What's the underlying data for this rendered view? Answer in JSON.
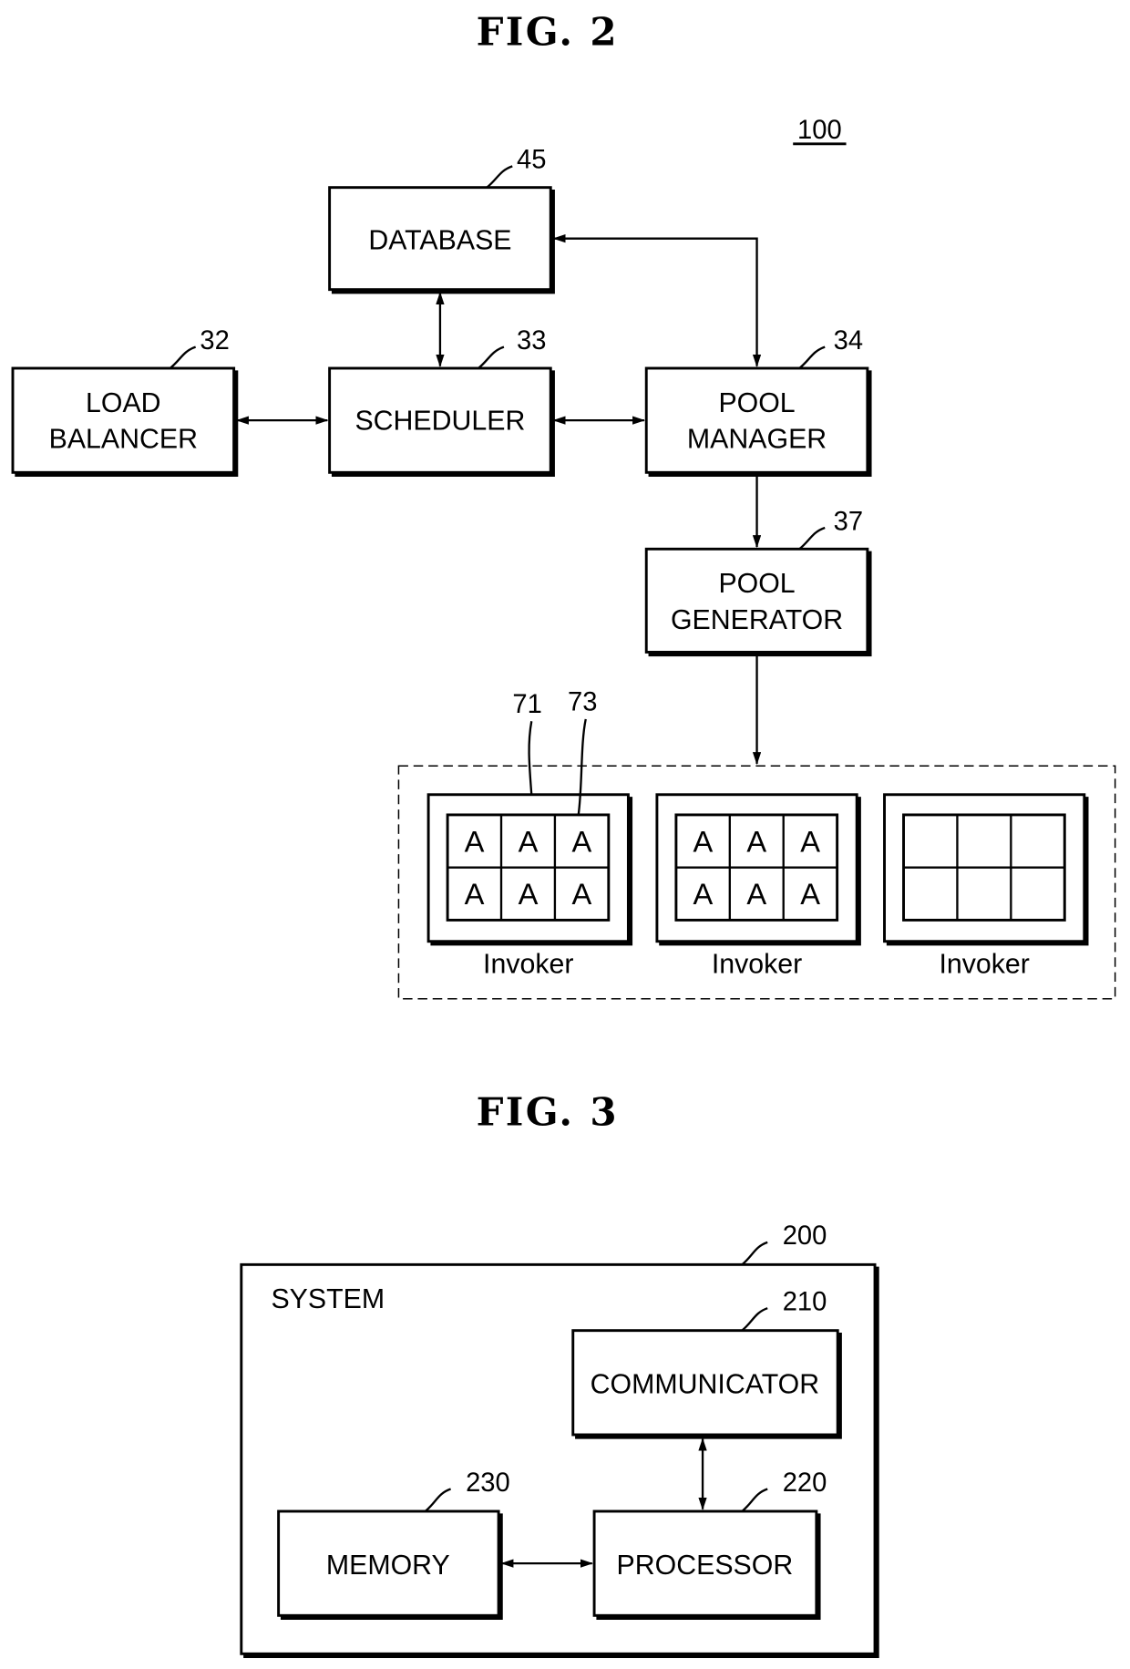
{
  "fig2": {
    "title": "FIG. 2",
    "system_ref": "100",
    "nodes": {
      "database": {
        "label": "DATABASE",
        "ref": "45"
      },
      "load_balancer": {
        "line1": "LOAD",
        "line2": "BALANCER",
        "ref": "32"
      },
      "scheduler": {
        "label": "SCHEDULER",
        "ref": "33"
      },
      "pool_manager": {
        "line1": "POOL",
        "line2": "MANAGER",
        "ref": "34"
      },
      "pool_generator": {
        "line1": "POOL",
        "line2": "GENERATOR",
        "ref": "37"
      }
    },
    "invoker_ref": "71",
    "container_ref": "73",
    "invokers": [
      {
        "label": "Invoker",
        "cells": [
          "A",
          "A",
          "A",
          "A",
          "A",
          "A"
        ]
      },
      {
        "label": "Invoker",
        "cells": [
          "A",
          "A",
          "A",
          "A",
          "A",
          "A"
        ]
      },
      {
        "label": "Invoker",
        "cells": [
          "",
          "",
          "",
          "",
          "",
          ""
        ]
      }
    ],
    "edges": [
      {
        "from": "load_balancer",
        "to": "scheduler",
        "direction": "bidirectional"
      },
      {
        "from": "scheduler",
        "to": "pool_manager",
        "direction": "bidirectional"
      },
      {
        "from": "database",
        "to": "scheduler",
        "direction": "bidirectional"
      },
      {
        "from": "pool_manager",
        "to": "database",
        "direction": "bidirectional"
      },
      {
        "from": "pool_manager",
        "to": "pool_generator",
        "direction": "forward"
      },
      {
        "from": "pool_generator",
        "to": "invoker_pool",
        "direction": "forward"
      }
    ]
  },
  "fig3": {
    "title": "FIG. 3",
    "system": {
      "label": "SYSTEM",
      "ref": "200"
    },
    "nodes": {
      "communicator": {
        "label": "COMMUNICATOR",
        "ref": "210"
      },
      "processor": {
        "label": "PROCESSOR",
        "ref": "220"
      },
      "memory": {
        "label": "MEMORY",
        "ref": "230"
      }
    },
    "edges": [
      {
        "from": "communicator",
        "to": "processor",
        "direction": "bidirectional"
      },
      {
        "from": "memory",
        "to": "processor",
        "direction": "bidirectional"
      }
    ]
  }
}
